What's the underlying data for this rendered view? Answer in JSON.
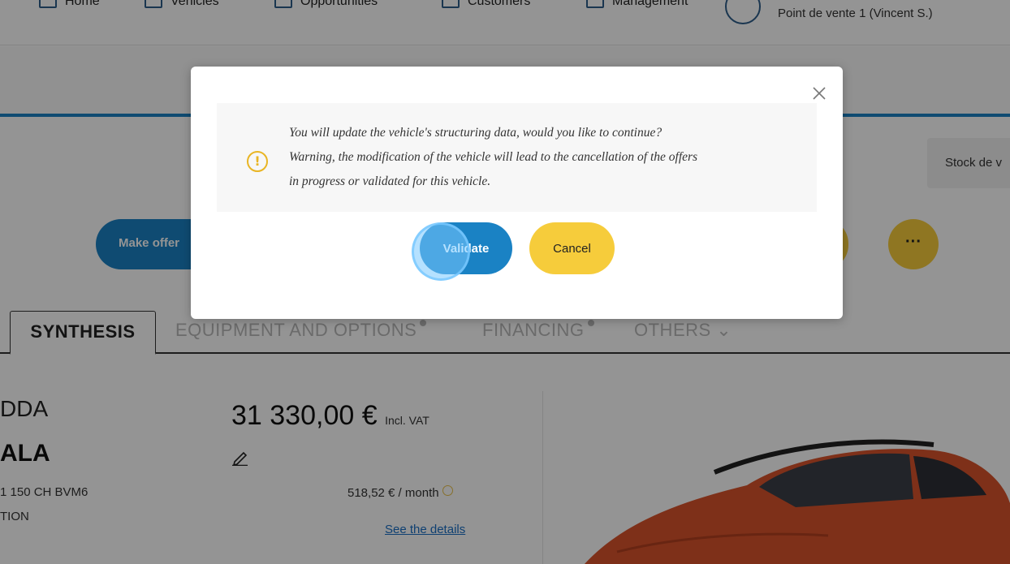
{
  "nav": {
    "items": [
      {
        "label": "Home"
      },
      {
        "label": "Vehicles"
      },
      {
        "label": "Opportunities"
      },
      {
        "label": "Customers"
      },
      {
        "label": "Management"
      }
    ],
    "store": "Point de vente 1 (Vincent S.)"
  },
  "actions": {
    "make_offer": "Make offer",
    "stock": "Stock de v",
    "more": "···"
  },
  "tabs": {
    "synthesis": "SYNTHESIS",
    "equipment": "EQUIPMENT AND OPTIONS",
    "financing": "FINANCING",
    "others": "OTHERS ⌄"
  },
  "vehicle": {
    "brand": "DDA",
    "model": "ALA",
    "engine": "1 150 CH BVM6",
    "finish": "TION",
    "price": "31 330,00 €",
    "price_suffix": "Incl. VAT",
    "monthly": "518,52 € / month",
    "details_link": "See the details"
  },
  "modal": {
    "line1": "You will update the vehicle's structuring data, would you like to continue?",
    "line2": "Warning, the modification of the vehicle will lead to the cancellation of the offers",
    "line3": "in progress or validated for this vehicle.",
    "validate": "Validate",
    "cancel": "Cancel"
  },
  "colors": {
    "primary_blue": "#1a82c4",
    "accent_yellow": "#f6cc3b",
    "warning_amber": "#e9b524"
  }
}
